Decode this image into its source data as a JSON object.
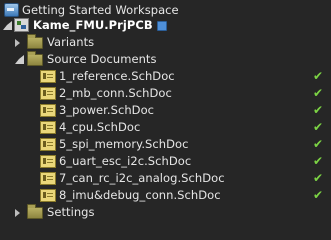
{
  "workspace": {
    "label": "Getting Started Workspace",
    "icon": "workspace-icon"
  },
  "project": {
    "label": "Kame_FMU.PrjPCB",
    "icon": "pcb-project-icon",
    "status_icon": "modified-document-icon"
  },
  "folders": {
    "variants": "Variants",
    "source_documents": "Source Documents",
    "settings": "Settings"
  },
  "documents": [
    {
      "label": "1_reference.SchDoc",
      "status": "✔"
    },
    {
      "label": "2_mb_conn.SchDoc",
      "status": "✔"
    },
    {
      "label": "3_power.SchDoc",
      "status": "✔"
    },
    {
      "label": "4_cpu.SchDoc",
      "status": "✔"
    },
    {
      "label": "5_spi_memory.SchDoc",
      "status": "✔"
    },
    {
      "label": "6_uart_esc_i2c.SchDoc",
      "status": "✔"
    },
    {
      "label": "7_can_rc_i2c_analog.SchDoc",
      "status": "✔"
    },
    {
      "label": "8_imu&debug_conn.SchDoc",
      "status": "✔"
    }
  ],
  "colors": {
    "background": "#262626",
    "text": "#e6e6e6",
    "check": "#7cd444",
    "folder": "#b9b063",
    "schdoc": "#ead77a"
  }
}
